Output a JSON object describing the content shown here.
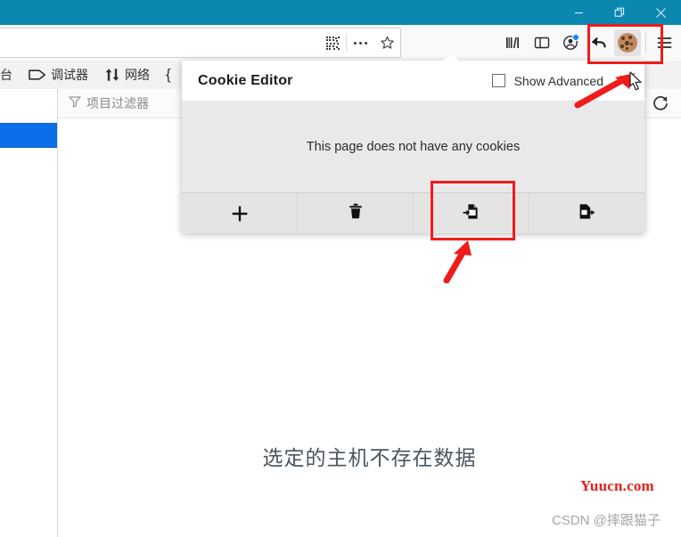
{
  "window": {
    "titlebar_color": "#0b87b0",
    "controls": [
      {
        "name": "minimize",
        "glyph": "–"
      },
      {
        "name": "restore",
        "glyph": "❐"
      },
      {
        "name": "close",
        "glyph": "×"
      }
    ]
  },
  "navbar": {
    "url_value": "",
    "url_placeholder": "",
    "url_icons": [
      {
        "name": "qr-code-icon"
      },
      {
        "name": "page-actions-icon",
        "glyph": "•••"
      },
      {
        "name": "bookmark-star-icon"
      }
    ],
    "toolbar_icons": [
      {
        "name": "library-icon"
      },
      {
        "name": "sidebar-icon"
      },
      {
        "name": "account-icon"
      },
      {
        "name": "back-icon"
      },
      {
        "name": "cookie-editor-icon"
      },
      {
        "name": "app-menu-icon"
      }
    ]
  },
  "devtools": {
    "tabs": [
      {
        "label": "台",
        "icon": "console-icon"
      },
      {
        "label": "调试器",
        "icon": "debugger-tag-icon"
      },
      {
        "label": "网络",
        "icon": "network-arrows-icon"
      },
      {
        "label": "{",
        "icon": "style-editor-icon"
      }
    ],
    "filter_placeholder": "项目过滤器",
    "refresh_label": "refresh",
    "empty_message": "选定的主机不存在数据",
    "selected_row_color": "#0a6fe8"
  },
  "cookie_editor": {
    "title": "Cookie Editor",
    "show_advanced_label": "Show Advanced",
    "show_advanced_checked": false,
    "close_label": "×",
    "body_message": "This page does not have any cookies",
    "footer_buttons": [
      {
        "name": "add-cookie-button",
        "icon": "plus-icon",
        "label": "+"
      },
      {
        "name": "delete-all-button",
        "icon": "trash-icon",
        "label": ""
      },
      {
        "name": "import-button",
        "icon": "import-document-icon",
        "label": ""
      },
      {
        "name": "export-button",
        "icon": "export-document-icon",
        "label": ""
      }
    ]
  },
  "annotations": {
    "highlight_color": "#f01b1b",
    "boxes": [
      {
        "name": "cookie-icon-highlight"
      },
      {
        "name": "import-button-highlight"
      }
    ],
    "arrows": [
      {
        "name": "arrow-to-cookie-icon"
      },
      {
        "name": "arrow-to-import-button"
      }
    ]
  },
  "watermarks": {
    "site": "Yuucn.com",
    "author": "CSDN @摔跟猫子"
  }
}
